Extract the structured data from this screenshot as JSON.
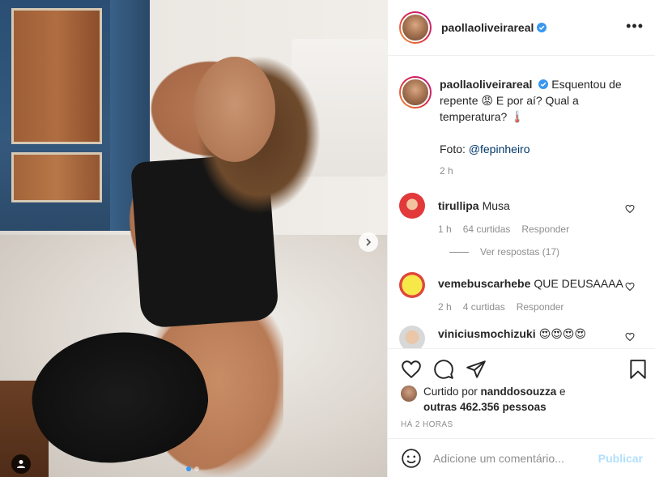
{
  "post": {
    "author": "paollaoliveirareal",
    "caption_line1": "Esquentou de",
    "caption_line2": "repente 😡 E por aí? Qual a",
    "caption_line3": "temperatura? 🌡️",
    "caption_credit_prefix": "Foto: ",
    "caption_credit_mention": "@fepinheiro",
    "caption_time": "2 h"
  },
  "comments": [
    {
      "user": "tirullipa",
      "text": "Musa",
      "time": "1 h",
      "likes": "64 curtidas",
      "reply": "Responder",
      "view_replies": "Ver respostas (17)"
    },
    {
      "user": "vemebuscarhebe",
      "text": "QUE DEUSAAAA",
      "time": "2 h",
      "likes": "4 curtidas",
      "reply": "Responder"
    },
    {
      "user": "viniciusmochizuki",
      "text": "😍😍😍😍"
    }
  ],
  "likes": {
    "prefix": "Curtido por ",
    "user": "nanddosouzza",
    "connector": " e",
    "others": "outras 462.356 pessoas"
  },
  "timestamp": "HÁ 2 HORAS",
  "comment_box": {
    "placeholder": "Adicione um comentário...",
    "publish": "Publicar"
  },
  "carousel": {
    "current_slide": 1,
    "total_slides": 2
  },
  "colors": {
    "accent": "#3897f0",
    "publish_disabled": "#b2dffc",
    "muted": "#8e8e8e",
    "mention": "#00376b"
  },
  "icons": [
    "more-options-icon",
    "verified-icon",
    "heart-icon",
    "comment-icon",
    "share-icon",
    "bookmark-icon",
    "emoji-icon",
    "next-arrow-icon",
    "user-tag-icon"
  ]
}
